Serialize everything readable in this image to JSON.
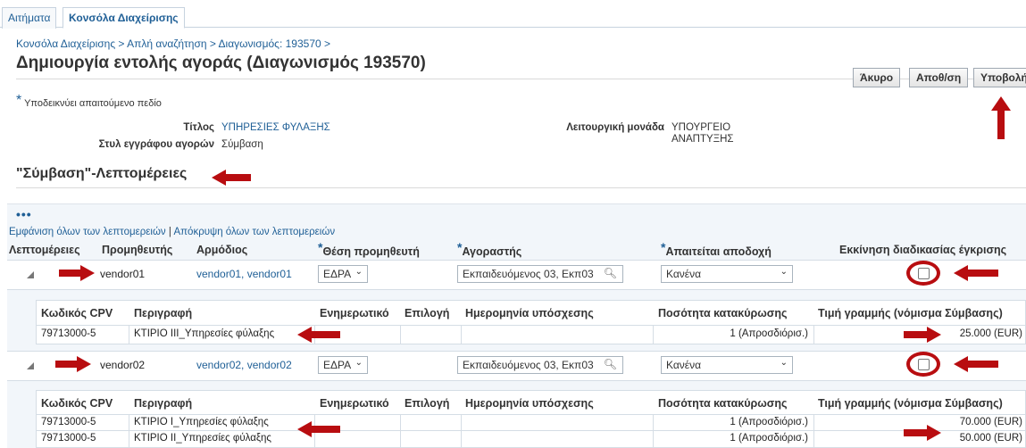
{
  "tabs": [
    "Αιτήματα",
    "Κονσόλα Διαχείρισης"
  ],
  "breadcrumbs": "Κονσόλα Διαχείρισης > Απλή αναζήτηση > Διαγωνισμός: 193570 >",
  "page_title": "Δημιουργία εντολής αγοράς (Διαγωνισμός 193570)",
  "buttons": {
    "cancel": "Άκυρο",
    "save": "Αποθ/ση",
    "submit": "Υποβολή"
  },
  "required_note": "Υποδεικνύει απαιτούμενο πεδίο",
  "fields": {
    "title_label": "Τίτλος",
    "title_value": "ΥΠΗΡΕΣΙΕΣ ΦΥΛΑΞΗΣ",
    "style_label": "Στυλ εγγράφου αγορών",
    "style_value": "Σύμβαση",
    "unit_label": "Λειτουργική μονάδα",
    "unit_value_1": "ΥΠΟΥΡΓΕΙΟ",
    "unit_value_2": "ΑΝΑΠΤΥΞΗΣ"
  },
  "section_title": "\"Σύμβαση\"-Λεπτομέρειες",
  "show_all": "Εμφάνιση όλων των λεπτομερειών",
  "separator": "|",
  "hide_all": "Απόκρυψη όλων των λεπτομερειών",
  "main_columns": [
    "Λεπτομέρειες",
    "Προμηθευτής",
    "Αρμόδιος",
    "Θέση προμηθευτή",
    "Αγοραστής",
    "Απαιτείται αποδοχή",
    "Εκκίνηση διαδικασίας έγκρισης"
  ],
  "suppliers": [
    {
      "supplier": "vendor01",
      "contacts": "vendor01, vendor01",
      "site": "ΕΔΡΑ",
      "buyer": "Εκπαιδευόμενος 03, Εκπ03",
      "acceptance": "Κανένα",
      "lines": [
        {
          "cpv": "79713000-5",
          "desc": "ΚΤΙΡΙΟ ΙΙΙ_Υπηρεσίες φύλαξης",
          "qty": "1 (Απροσδιόρισ.)",
          "price": "25.000 (EUR)"
        }
      ]
    },
    {
      "supplier": "vendor02",
      "contacts": "vendor02, vendor02",
      "site": "ΕΔΡΑ",
      "buyer": "Εκπαιδευόμενος 03, Εκπ03",
      "acceptance": "Κανένα",
      "lines": [
        {
          "cpv": "79713000-5",
          "desc": "ΚΤΙΡΙΟ Ι_Υπηρεσίες φύλαξης",
          "qty": "1 (Απροσδιόρισ.)",
          "price": "70.000 (EUR)"
        },
        {
          "cpv": "79713000-5",
          "desc": "ΚΤΙΡΙΟ ΙΙ_Υπηρεσίες φύλαξης",
          "qty": "1 (Απροσδιόρισ.)",
          "price": "50.000 (EUR)"
        }
      ]
    }
  ],
  "sub_columns": [
    "Κωδικός CPV",
    "Περιγραφή",
    "Ενημερωτικό",
    "Επιλογή",
    "Ημερομηνία υπόσχεσης",
    "Ποσότητα κατακύρωσης",
    "Τιμή γραμμής (νόμισμα Σύμβασης)"
  ],
  "colors": {
    "link": "#1f5f96",
    "annotation": "#b80d10"
  },
  "icons": {
    "expand": "triangle-expand-icon",
    "search": "magnifier-icon",
    "dropdown": "chevron-down-icon",
    "annotation": "red-arrow-icon"
  }
}
